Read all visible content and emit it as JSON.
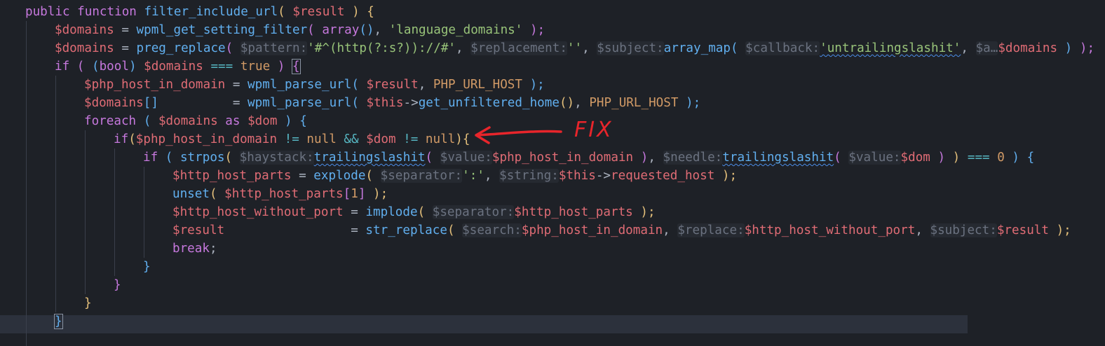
{
  "editor": {
    "lines": [
      [
        {
          "t": "public",
          "c": "kw"
        },
        {
          "t": " ",
          "c": "pl"
        },
        {
          "t": "function",
          "c": "kw"
        },
        {
          "t": " ",
          "c": "pl"
        },
        {
          "t": "filter_include_url",
          "c": "fn"
        },
        {
          "t": "( ",
          "c": "p1"
        },
        {
          "t": "$result",
          "c": "var"
        },
        {
          "t": " ) ",
          "c": "p1"
        },
        {
          "t": "{",
          "c": "p1"
        }
      ],
      [
        {
          "t": "$domains",
          "c": "var"
        },
        {
          "t": " = ",
          "c": "pl"
        },
        {
          "t": "wpml_get_setting_filter",
          "c": "fn"
        },
        {
          "t": "( ",
          "c": "p2"
        },
        {
          "t": "array",
          "c": "kw"
        },
        {
          "t": "()",
          "c": "p3"
        },
        {
          "t": ", ",
          "c": "pl"
        },
        {
          "t": "'language_domains'",
          "c": "str"
        },
        {
          "t": " );",
          "c": "p2"
        }
      ],
      [
        {
          "t": "$domains",
          "c": "var"
        },
        {
          "t": " = ",
          "c": "pl"
        },
        {
          "t": "preg_replace",
          "c": "fn"
        },
        {
          "t": "( ",
          "c": "p2"
        },
        {
          "t": "$pattern:",
          "c": "hint"
        },
        {
          "t": "'#^(http(?:s?))://#'",
          "c": "str"
        },
        {
          "t": ", ",
          "c": "pl"
        },
        {
          "t": "$replacement:",
          "c": "hint"
        },
        {
          "t": "''",
          "c": "str"
        },
        {
          "t": ", ",
          "c": "pl"
        },
        {
          "t": "$subject:",
          "c": "hint"
        },
        {
          "t": "array_map",
          "c": "fn"
        },
        {
          "t": "( ",
          "c": "p3"
        },
        {
          "t": "$callback:",
          "c": "hint"
        },
        {
          "t": "'untrailingslashit'",
          "c": "str",
          "w": true
        },
        {
          "t": ", ",
          "c": "pl"
        },
        {
          "t": "$a…",
          "c": "hint"
        },
        {
          "t": "$domains",
          "c": "var"
        },
        {
          "t": " ) ",
          "c": "p3"
        },
        {
          "t": ");",
          "c": "p2"
        }
      ],
      [
        {
          "t": "if",
          "c": "kw"
        },
        {
          "t": " ( ",
          "c": "p2"
        },
        {
          "t": "(",
          "c": "p3"
        },
        {
          "t": "bool",
          "c": "kw"
        },
        {
          "t": ")",
          "c": "p3"
        },
        {
          "t": " ",
          "c": "pl"
        },
        {
          "t": "$domains",
          "c": "var"
        },
        {
          "t": " === ",
          "c": "op"
        },
        {
          "t": "true",
          "c": "const"
        },
        {
          "t": " ) ",
          "c": "p2"
        },
        {
          "t": "{",
          "c": "p2",
          "b": true
        }
      ],
      [
        {
          "t": "$php_host_in_domain",
          "c": "var"
        },
        {
          "t": " = ",
          "c": "pl"
        },
        {
          "t": "wpml_parse_url",
          "c": "fn"
        },
        {
          "t": "( ",
          "c": "p3"
        },
        {
          "t": "$result",
          "c": "var"
        },
        {
          "t": ", ",
          "c": "pl"
        },
        {
          "t": "PHP_URL_HOST",
          "c": "const"
        },
        {
          "t": " );",
          "c": "p3"
        }
      ],
      [
        {
          "t": "$domains",
          "c": "var"
        },
        {
          "t": "[]",
          "c": "p3"
        },
        {
          "t": "          = ",
          "c": "pl"
        },
        {
          "t": "wpml_parse_url",
          "c": "fn"
        },
        {
          "t": "( ",
          "c": "p3"
        },
        {
          "t": "$this",
          "c": "var"
        },
        {
          "t": "->",
          "c": "pl"
        },
        {
          "t": "get_unfiltered_home",
          "c": "fn"
        },
        {
          "t": "()",
          "c": "p1"
        },
        {
          "t": ", ",
          "c": "pl"
        },
        {
          "t": "PHP_URL_HOST",
          "c": "const"
        },
        {
          "t": " );",
          "c": "p3"
        }
      ],
      [
        {
          "t": "foreach",
          "c": "kw"
        },
        {
          "t": " ( ",
          "c": "p3"
        },
        {
          "t": "$domains",
          "c": "var"
        },
        {
          "t": " as ",
          "c": "kw"
        },
        {
          "t": "$dom",
          "c": "var"
        },
        {
          "t": " ) ",
          "c": "p3"
        },
        {
          "t": "{",
          "c": "p3"
        }
      ],
      [
        {
          "t": "if",
          "c": "kw"
        },
        {
          "t": "(",
          "c": "p1"
        },
        {
          "t": "$php_host_in_domain",
          "c": "var"
        },
        {
          "t": " != ",
          "c": "op"
        },
        {
          "t": "null",
          "c": "const"
        },
        {
          "t": " && ",
          "c": "op"
        },
        {
          "t": "$dom",
          "c": "var"
        },
        {
          "t": " != ",
          "c": "op"
        },
        {
          "t": "null",
          "c": "const"
        },
        {
          "t": ")",
          "c": "p1"
        },
        {
          "t": "{",
          "c": "p1"
        }
      ],
      [
        {
          "t": "if",
          "c": "kw"
        },
        {
          "t": " ( ",
          "c": "p3"
        },
        {
          "t": "strpos",
          "c": "fn"
        },
        {
          "t": "( ",
          "c": "p1"
        },
        {
          "t": "$haystack:",
          "c": "hint"
        },
        {
          "t": "trailingslashit",
          "c": "fn",
          "w": true
        },
        {
          "t": "( ",
          "c": "p2"
        },
        {
          "t": "$value:",
          "c": "hint"
        },
        {
          "t": "$php_host_in_domain",
          "c": "var"
        },
        {
          "t": " )",
          "c": "p2"
        },
        {
          "t": ", ",
          "c": "pl"
        },
        {
          "t": "$needle:",
          "c": "hint"
        },
        {
          "t": "trailingslashit",
          "c": "fn",
          "w": true
        },
        {
          "t": "( ",
          "c": "p2"
        },
        {
          "t": "$value:",
          "c": "hint"
        },
        {
          "t": "$dom",
          "c": "var"
        },
        {
          "t": " ) ",
          "c": "p2"
        },
        {
          "t": ")",
          "c": "p1"
        },
        {
          "t": " === ",
          "c": "op"
        },
        {
          "t": "0",
          "c": "num"
        },
        {
          "t": " ) ",
          "c": "p3"
        },
        {
          "t": "{",
          "c": "p3"
        }
      ],
      [
        {
          "t": "$http_host_parts",
          "c": "var"
        },
        {
          "t": " = ",
          "c": "pl"
        },
        {
          "t": "explode",
          "c": "fn"
        },
        {
          "t": "( ",
          "c": "p1"
        },
        {
          "t": "$separator:",
          "c": "hint"
        },
        {
          "t": "':'",
          "c": "str"
        },
        {
          "t": ", ",
          "c": "pl"
        },
        {
          "t": "$string:",
          "c": "hint"
        },
        {
          "t": "$this",
          "c": "var"
        },
        {
          "t": "->",
          "c": "pl"
        },
        {
          "t": "requested_host",
          "c": "var"
        },
        {
          "t": " );",
          "c": "p1"
        }
      ],
      [
        {
          "t": "unset",
          "c": "fn"
        },
        {
          "t": "( ",
          "c": "p1"
        },
        {
          "t": "$http_host_parts",
          "c": "var"
        },
        {
          "t": "[",
          "c": "p2"
        },
        {
          "t": "1",
          "c": "num"
        },
        {
          "t": "]",
          "c": "p2"
        },
        {
          "t": " );",
          "c": "p1"
        }
      ],
      [
        {
          "t": "$http_host_without_port",
          "c": "var"
        },
        {
          "t": " = ",
          "c": "pl"
        },
        {
          "t": "implode",
          "c": "fn"
        },
        {
          "t": "( ",
          "c": "p1"
        },
        {
          "t": "$separator:",
          "c": "hint"
        },
        {
          "t": "$http_host_parts",
          "c": "var"
        },
        {
          "t": " );",
          "c": "p1"
        }
      ],
      [
        {
          "t": "$result",
          "c": "var"
        },
        {
          "t": "                 = ",
          "c": "pl"
        },
        {
          "t": "str_replace",
          "c": "fn"
        },
        {
          "t": "( ",
          "c": "p1"
        },
        {
          "t": "$search:",
          "c": "hint"
        },
        {
          "t": "$php_host_in_domain",
          "c": "var"
        },
        {
          "t": ", ",
          "c": "pl"
        },
        {
          "t": "$replace:",
          "c": "hint"
        },
        {
          "t": "$http_host_without_port",
          "c": "var"
        },
        {
          "t": ", ",
          "c": "pl"
        },
        {
          "t": "$subject:",
          "c": "hint"
        },
        {
          "t": "$result",
          "c": "var"
        },
        {
          "t": " );",
          "c": "p1"
        }
      ],
      [
        {
          "t": "break",
          "c": "kw"
        },
        {
          "t": ";",
          "c": "pl"
        }
      ],
      [
        {
          "t": "}",
          "c": "p3"
        }
      ],
      [
        {
          "t": "}",
          "c": "p2"
        }
      ],
      [
        {
          "t": "}",
          "c": "p1"
        }
      ],
      [
        {
          "t": "}",
          "c": "p3",
          "b": true
        }
      ]
    ]
  },
  "annotation": {
    "label": "FIX",
    "color": "#e8252b"
  },
  "theme": {
    "background": "#1e2127",
    "current_line": "#2c313c",
    "keyword": "#c678dd",
    "function": "#61afef",
    "variable": "#e06c75",
    "string": "#98c379",
    "constant": "#d19a66"
  }
}
